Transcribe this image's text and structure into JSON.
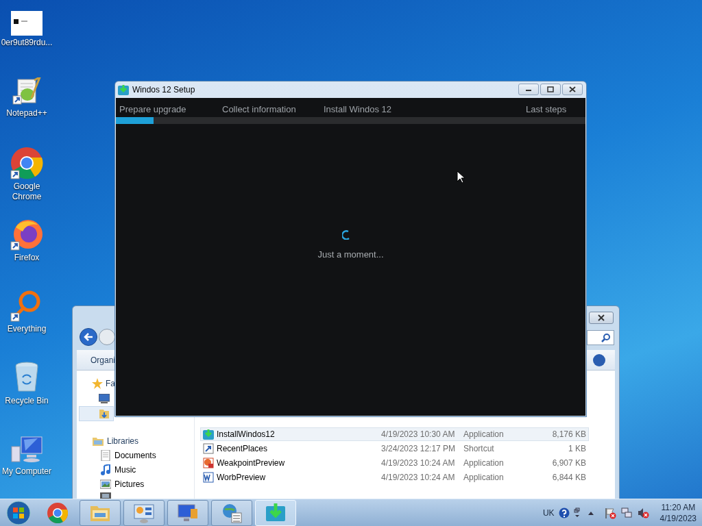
{
  "desktop_icons": [
    {
      "kind": "document",
      "label": "0er9ut89rdu..."
    },
    {
      "kind": "notepad",
      "label": "Notepad++"
    },
    {
      "kind": "chrome",
      "label": "Google Chrome"
    },
    {
      "kind": "firefox",
      "label": "Firefox"
    },
    {
      "kind": "everything",
      "label": "Everything"
    },
    {
      "kind": "recycle",
      "label": "Recycle Bin"
    },
    {
      "kind": "computer",
      "label": "My Computer"
    }
  ],
  "explorer": {
    "toolbar": {
      "organize": "Organi"
    },
    "sidebar": {
      "favorites": "Fa",
      "libraries": "Libraries",
      "library_items": [
        {
          "kind": "documents",
          "label": "Documents"
        },
        {
          "kind": "music",
          "label": "Music"
        },
        {
          "kind": "pictures",
          "label": "Pictures"
        }
      ]
    },
    "files": [
      {
        "kind": "installer",
        "name": "InstallWindos12",
        "date": "4/19/2023 10:30 AM",
        "type": "Application",
        "size": "8,176 KB",
        "selected": true
      },
      {
        "kind": "shortcut",
        "name": "RecentPlaces",
        "date": "3/24/2023 12:17 PM",
        "type": "Shortcut",
        "size": "1 KB",
        "selected": false
      },
      {
        "kind": "slides",
        "name": "WeakpointPreview",
        "date": "4/19/2023 10:24 AM",
        "type": "Application",
        "size": "6,907 KB",
        "selected": false
      },
      {
        "kind": "word",
        "name": "WorbPreview",
        "date": "4/19/2023 10:24 AM",
        "type": "Application",
        "size": "6,844 KB",
        "selected": false
      }
    ]
  },
  "setup": {
    "title": "Windos 12 Setup",
    "steps": [
      {
        "label": "Prepare upgrade"
      },
      {
        "label": "Collect information"
      },
      {
        "label": "Install Windos 12"
      },
      {
        "label": "Last steps"
      }
    ],
    "progress": {
      "level": 0.08
    },
    "status": "Just a moment..."
  },
  "taskbar": {
    "items": [
      {
        "kind": "chrome",
        "selected": false
      },
      {
        "kind": "folder",
        "selected": false
      },
      {
        "kind": "control",
        "selected": false
      },
      {
        "kind": "display",
        "selected": false
      },
      {
        "kind": "network",
        "selected": false
      },
      {
        "kind": "installer",
        "selected": true
      }
    ],
    "language": "UK",
    "time": "11:20 AM",
    "date": "4/19/2023"
  }
}
